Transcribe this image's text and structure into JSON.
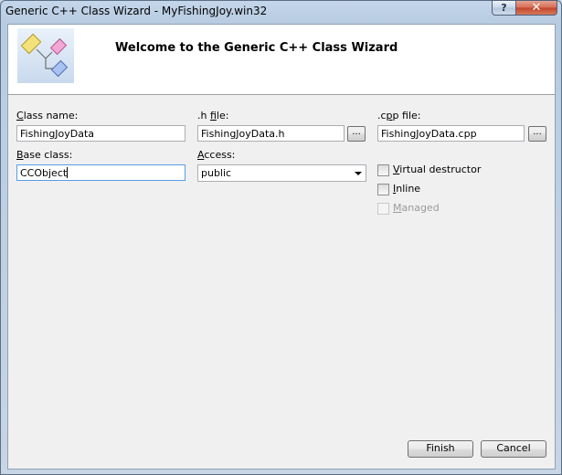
{
  "window": {
    "title": "Generic C++ Class Wizard - MyFishingJoy.win32",
    "help_label": "?",
    "close_label": "✕"
  },
  "header": {
    "welcome": "Welcome to the Generic C++ Class Wizard",
    "logo_icon": "class-diagram-icon"
  },
  "form": {
    "class_name": {
      "label_accel": "C",
      "label_rest": "lass name:",
      "value": "FishingJoyData"
    },
    "h_file": {
      "label_pre": ".h ",
      "label_accel": "f",
      "label_rest": "ile:",
      "value": "FishingJoyData.h",
      "browse": "..."
    },
    "cpp_file": {
      "label_pre": ".c",
      "label_accel": "p",
      "label_rest": "p file:",
      "value": "FishingJoyData.cpp",
      "browse": "..."
    },
    "base_class": {
      "label_accel": "B",
      "label_rest": "ase class:",
      "value": "CCObject"
    },
    "access": {
      "label_accel": "A",
      "label_rest": "ccess:",
      "value": "public"
    },
    "virtual_destructor": {
      "label_accel": "V",
      "label_rest": "irtual destructor",
      "checked": false
    },
    "inline": {
      "label_accel": "I",
      "label_rest": "nline",
      "checked": false
    },
    "managed": {
      "label_accel": "M",
      "label_rest": "anaged",
      "checked": false,
      "enabled": false
    }
  },
  "footer": {
    "finish_label": "Finish",
    "cancel_label": "Cancel"
  },
  "colors": {
    "frame": "#c4d6ea",
    "close_button": "#c1442a",
    "focus_border": "#569de5"
  }
}
